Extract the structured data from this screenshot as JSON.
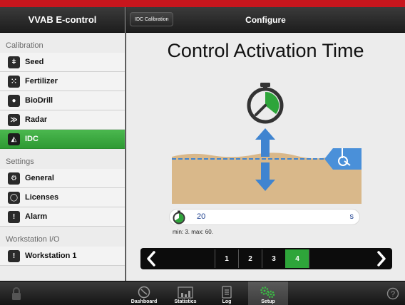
{
  "sidebar": {
    "title": "VVAB E-control",
    "sections": [
      {
        "title": "Calibration",
        "items": [
          {
            "label": "Seed",
            "icon": "seed-icon",
            "glyph": "ǂ"
          },
          {
            "label": "Fertilizer",
            "icon": "fertilizer-icon",
            "glyph": "⁙"
          },
          {
            "label": "BioDrill",
            "icon": "biodrill-icon",
            "glyph": "●"
          },
          {
            "label": "Radar",
            "icon": "radar-icon",
            "glyph": "≫"
          },
          {
            "label": "IDC",
            "icon": "idc-icon",
            "glyph": "◭",
            "active": true
          }
        ]
      },
      {
        "title": "Settings",
        "items": [
          {
            "label": "General",
            "icon": "general-icon",
            "glyph": "⚙"
          },
          {
            "label": "Licenses",
            "icon": "licenses-icon",
            "glyph": "◯"
          },
          {
            "label": "Alarm",
            "icon": "alarm-icon",
            "glyph": "!"
          }
        ]
      },
      {
        "title": "Workstation I/O",
        "items": [
          {
            "label": "Workstation 1",
            "icon": "workstation-icon",
            "glyph": "!"
          }
        ]
      }
    ]
  },
  "header": {
    "back_label": "IDC Calibration",
    "title": "Configure"
  },
  "main": {
    "title": "Control Activation Time",
    "value": "20",
    "unit": "s",
    "range": "min: 3. max: 60.",
    "pages": [
      "1",
      "2",
      "3",
      "4"
    ],
    "active_page": "4"
  },
  "bottom_tabs": [
    {
      "label": "Dashboard",
      "icon": "dashboard-icon"
    },
    {
      "label": "Statistics",
      "icon": "statistics-icon"
    },
    {
      "label": "Log",
      "icon": "log-icon"
    },
    {
      "label": "Setup",
      "icon": "setup-icon",
      "active": true
    }
  ],
  "colors": {
    "accent_green": "#2ea53a",
    "brand_red": "#c8161d",
    "value_blue": "#1c3f8e",
    "soil": "#d9b88a",
    "arrow_blue": "#3f84d0"
  }
}
